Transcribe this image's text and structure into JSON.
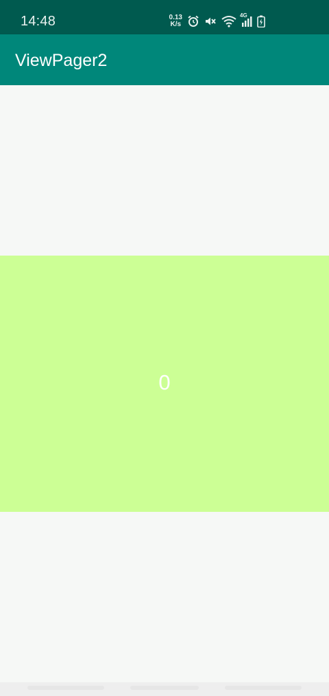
{
  "status_bar": {
    "time": "14:48",
    "net_speed_value": "0.13",
    "net_speed_unit": "K/s",
    "network_type": "4G",
    "icons": [
      "alarm-icon",
      "mute-icon",
      "wifi-icon",
      "signal-icon",
      "battery-charging-icon"
    ],
    "colors": {
      "background": "#005a4f",
      "foreground": "#e8f1ef"
    }
  },
  "app_bar": {
    "title": "ViewPager2",
    "colors": {
      "background": "#00877a",
      "text": "#ffffff"
    }
  },
  "pager": {
    "current_page_label": "0",
    "colors": {
      "background": "#f6f8f6",
      "page": "#ccff95",
      "text": "#ffffff"
    }
  }
}
